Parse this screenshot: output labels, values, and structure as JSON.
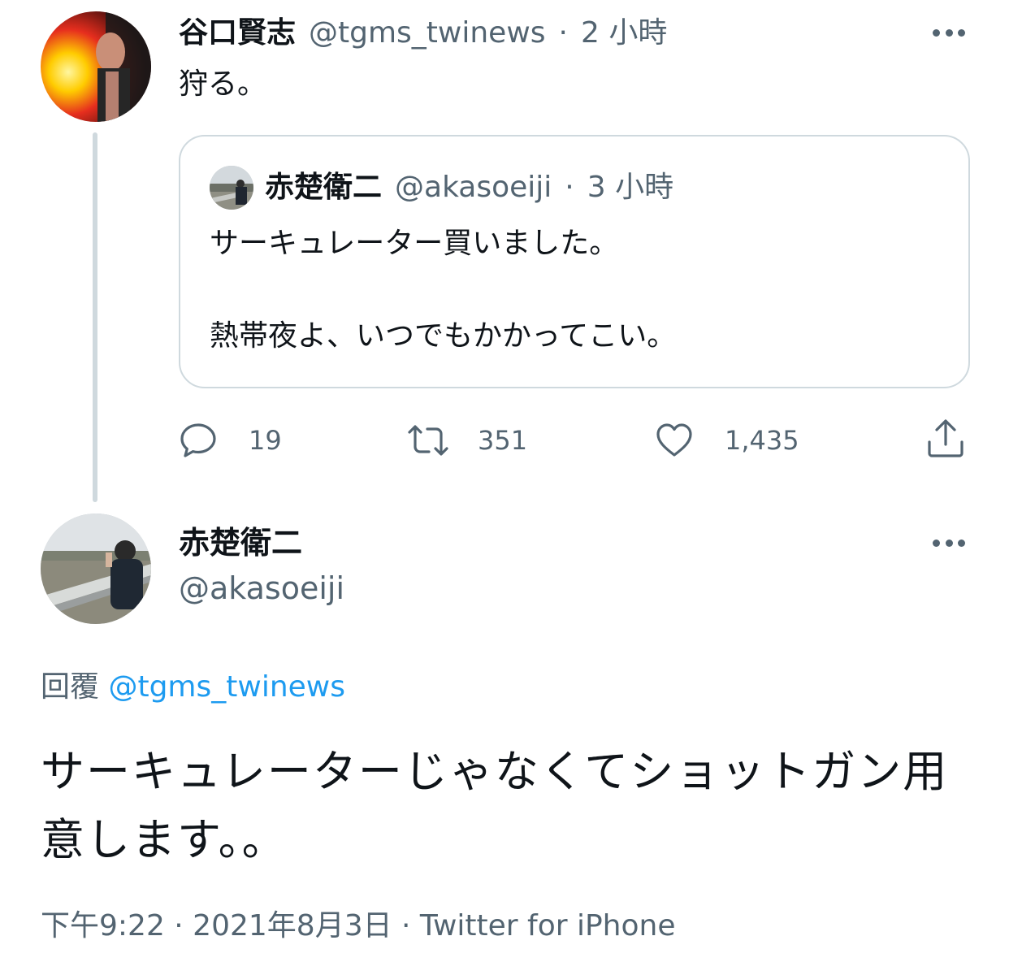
{
  "parent_tweet": {
    "display_name": "谷口賢志",
    "handle": "@tgms_twinews",
    "separator": "·",
    "time_ago": "2 小時",
    "text": "狩る。",
    "more_icon": "more-horizontal-icon",
    "quoted_tweet": {
      "display_name": "赤楚衛二",
      "handle": "@akasoeiji",
      "separator": "·",
      "time_ago": "3 小時",
      "line_1": "サーキュレーター買いました。",
      "line_2": "熱帯夜よ、いつでもかかってこい。"
    },
    "actions": {
      "reply_count": "19",
      "retweet_count": "351",
      "like_count": "1,435",
      "reply_icon": "comment-icon",
      "retweet_icon": "retweet-icon",
      "like_icon": "heart-icon",
      "share_icon": "share-icon"
    }
  },
  "reply_tweet": {
    "display_name": "赤楚衛二",
    "handle": "@akasoeiji",
    "more_icon": "more-horizontal-icon",
    "replying_to_label": "回覆",
    "replying_to_handle": "@tgms_twinews",
    "text": "サーキュレーターじゃなくてショットガン用意します。。",
    "timestamp": "下午9:22 · 2021年8月3日 · Twitter for iPhone"
  },
  "colors": {
    "text_primary": "#0f1419",
    "text_secondary": "#536471",
    "link": "#1d9bf0",
    "border": "#cfd9de"
  }
}
